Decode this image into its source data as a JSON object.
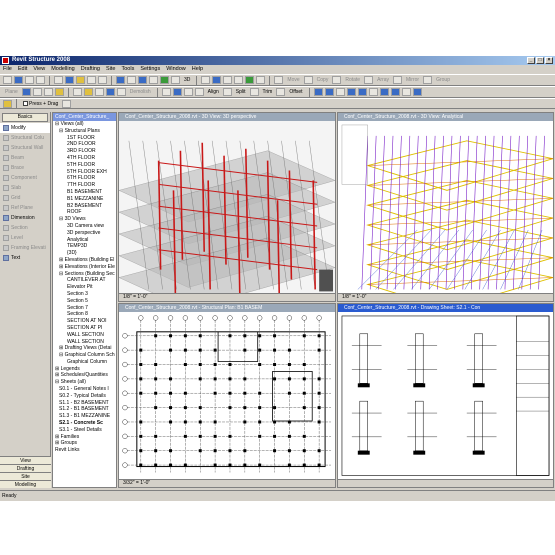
{
  "window": {
    "title": "Revit Structure 2008"
  },
  "menu": [
    "File",
    "Edit",
    "View",
    "Modelling",
    "Drafting",
    "Site",
    "Tools",
    "Settings",
    "Window",
    "Help"
  ],
  "toolbar1": {
    "labels": [
      "3D"
    ],
    "dim_labels": [
      "Move",
      "Copy",
      "Rotate",
      "Array",
      "Mirror",
      "Group"
    ]
  },
  "toolbar2": {
    "dim_labels": [
      "Plane",
      "Demolish"
    ],
    "labels": [
      "Align",
      "Split",
      "Trim",
      "Offset"
    ]
  },
  "toolbar3": {
    "press_drag": "Press + Drag"
  },
  "designbar": {
    "header": "Basics",
    "items": [
      {
        "label": "Modify",
        "enabled": true
      },
      {
        "label": "Structural Colu",
        "enabled": false
      },
      {
        "label": "Structural Wall",
        "enabled": false
      },
      {
        "label": "Beam",
        "enabled": false
      },
      {
        "label": "Brace",
        "enabled": false
      },
      {
        "label": "Component",
        "enabled": false
      },
      {
        "label": "Slab",
        "enabled": false
      },
      {
        "label": "Grid",
        "enabled": false
      },
      {
        "label": "Ref Plane",
        "enabled": false
      },
      {
        "label": "Dimension",
        "enabled": true
      },
      {
        "label": "Section",
        "enabled": false
      },
      {
        "label": "Level",
        "enabled": false
      },
      {
        "label": "Framing Elevati",
        "enabled": false
      },
      {
        "label": "Text",
        "enabled": true
      }
    ],
    "tabs": [
      "View",
      "Drafting",
      "Site",
      "Modelling"
    ]
  },
  "browser": {
    "title": "Conf_Center_Structure_",
    "tree": [
      {
        "t": "⊟ Views (all)",
        "d": 0
      },
      {
        "t": "⊟ Structural Plans",
        "d": 1
      },
      {
        "t": "1ST FLOOR",
        "d": 3
      },
      {
        "t": "2ND FLOOR",
        "d": 3
      },
      {
        "t": "3RD FLOOR",
        "d": 3
      },
      {
        "t": "4TH FLOOR",
        "d": 3
      },
      {
        "t": "5TH FLOOR",
        "d": 3
      },
      {
        "t": "5TH FLOOR EXH",
        "d": 3
      },
      {
        "t": "6TH FLOOR",
        "d": 3
      },
      {
        "t": "7TH FLOOR",
        "d": 3
      },
      {
        "t": "B1 BASEMENT",
        "d": 3
      },
      {
        "t": "B1 MEZZANINE",
        "d": 3
      },
      {
        "t": "B2 BASEMENT",
        "d": 3
      },
      {
        "t": "ROOF",
        "d": 3
      },
      {
        "t": "⊟ 3D Views",
        "d": 1
      },
      {
        "t": "3D Camera view",
        "d": 3
      },
      {
        "t": "3D perspective",
        "d": 3
      },
      {
        "t": "Analytical",
        "d": 3
      },
      {
        "t": "TEMP3D",
        "d": 3
      },
      {
        "t": "{3D}",
        "d": 3
      },
      {
        "t": "⊞ Elevations (Building El",
        "d": 1
      },
      {
        "t": "⊞ Elevations (Interior Ele",
        "d": 1
      },
      {
        "t": "⊟ Sections (Building Sec",
        "d": 1
      },
      {
        "t": "CANTILEVER AT",
        "d": 3
      },
      {
        "t": "Elevator Pit",
        "d": 3
      },
      {
        "t": "Section 3",
        "d": 3
      },
      {
        "t": "Section 5",
        "d": 3
      },
      {
        "t": "Section 7",
        "d": 3
      },
      {
        "t": "Section 8",
        "d": 3
      },
      {
        "t": "SECTION AT NOI",
        "d": 3
      },
      {
        "t": "SECTION AT PI",
        "d": 3
      },
      {
        "t": "WALL SECTION",
        "d": 3
      },
      {
        "t": "WALL SECTION",
        "d": 3
      },
      {
        "t": "⊞ Drafting Views (Detai",
        "d": 1
      },
      {
        "t": "⊟ Graphical Column Sch",
        "d": 1
      },
      {
        "t": "Graphical Column",
        "d": 3
      },
      {
        "t": "⊞ Legends",
        "d": 0
      },
      {
        "t": "⊞ Schedules/Quantities",
        "d": 0
      },
      {
        "t": "⊟ Sheets (all)",
        "d": 0
      },
      {
        "t": "S0.1 - General Notes I",
        "d": 1
      },
      {
        "t": "S0.2 - Typical Details",
        "d": 1
      },
      {
        "t": "S1.1 - B2 BASEMENT",
        "d": 1
      },
      {
        "t": "S1.2 - B1 BASEMENT",
        "d": 1
      },
      {
        "t": "S1.3 - B1 MEZZANINE",
        "d": 1
      },
      {
        "t": "S2.1 - Concrete Sc",
        "d": 1,
        "b": true
      },
      {
        "t": "S3.1 - Steel Details",
        "d": 1
      },
      {
        "t": "⊞ Families",
        "d": 0
      },
      {
        "t": "⊞ Groups",
        "d": 0
      },
      {
        "t": "Revit Links",
        "d": 0
      }
    ]
  },
  "views": {
    "v1": {
      "title": "Conf_Center_Structure_2008.rvt - 3D View: 3D perspective",
      "scale": "1/8\" = 1'-0\""
    },
    "v2": {
      "title": "Conf_Center_Structure_2008.rvt - 3D View: Analytical",
      "scale": "1/8\" = 1'-0\""
    },
    "v3": {
      "title": "Conf_Center_Structure_2008.rvt - Structural Plan: B1 BASEM",
      "scale": "3/32\" = 1'-0\""
    },
    "v4": {
      "title": "Conf_Center_Structure_2008.rvt - Drawing Sheet: S2.1 - Con",
      "scale": ""
    }
  },
  "colors": {
    "steel": "#c81818",
    "analytical": "#7a20c8",
    "yellow": "#e0c000"
  },
  "status": {
    "text": "Ready"
  }
}
